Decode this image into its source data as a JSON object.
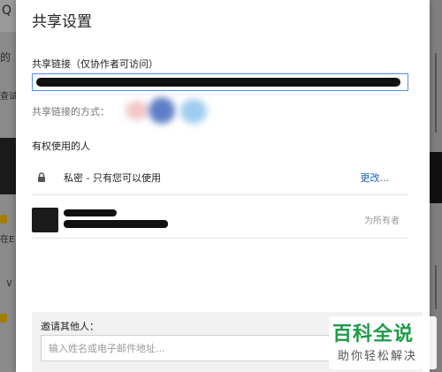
{
  "dialog": {
    "title": "共享设置",
    "share_link": {
      "label": "共享链接（仅协作者可访问）",
      "value_redacted": true
    },
    "share_methods_label": "共享链接的方式：",
    "access": {
      "label": "有权使用的人",
      "privacy": {
        "icon": "lock-icon",
        "text": "私密 - 只有您可以使用",
        "change_label": "更改..."
      },
      "owner": {
        "role_label": "为所有者",
        "name_redacted": true
      }
    },
    "invite": {
      "label": "邀请其他人：",
      "placeholder": "输入姓名或电子邮件地址..."
    }
  },
  "background": {
    "search_glyph": "Q",
    "frag_1": "的",
    "frag_2": "查试",
    "frag_3": "在E",
    "chevron": "∨"
  },
  "watermark": {
    "top": "百科全说",
    "bottom": "助你轻松解决",
    "color": "#1f9b4a"
  }
}
